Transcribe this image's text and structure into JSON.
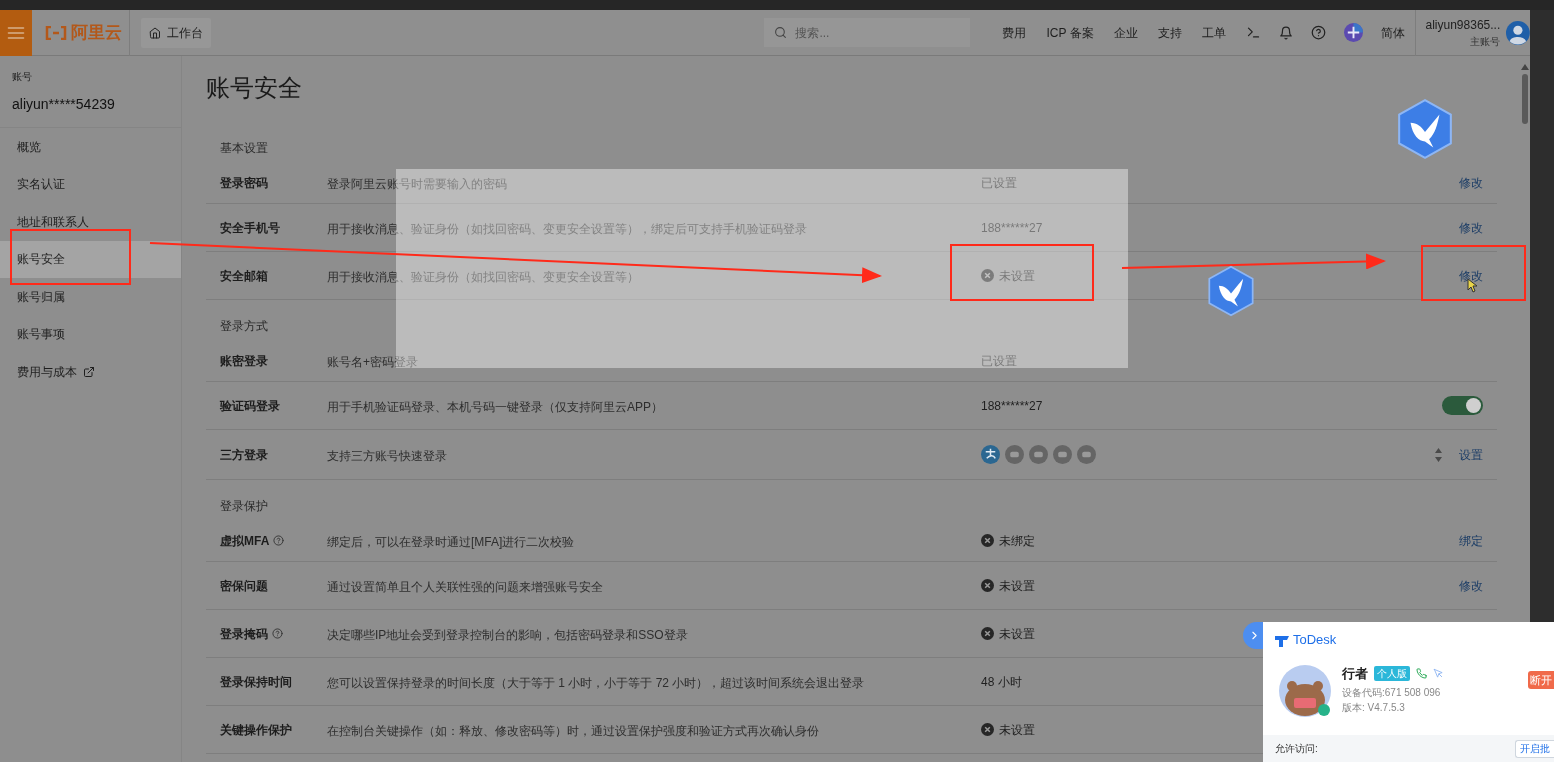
{
  "topbar": {
    "logo": "阿里云",
    "workbench": "工作台",
    "search": {
      "placeholder": "搜索..."
    },
    "nav": [
      "费用",
      "ICP 备案",
      "企业",
      "支持",
      "工单"
    ],
    "language": "简体",
    "user": {
      "name": "aliyun98365...",
      "role": "主账号"
    }
  },
  "sidebar": {
    "label": "账号",
    "account": "aliyun*****54239",
    "items": [
      {
        "label": "概览",
        "selected": false,
        "external": false
      },
      {
        "label": "实名认证",
        "selected": false,
        "external": false
      },
      {
        "label": "地址和联系人",
        "selected": false,
        "external": false
      },
      {
        "label": "账号安全",
        "selected": true,
        "external": false
      },
      {
        "label": "账号归属",
        "selected": false,
        "external": false
      },
      {
        "label": "账号事项",
        "selected": false,
        "external": false
      },
      {
        "label": "费用与成本",
        "selected": false,
        "external": true
      }
    ]
  },
  "page": {
    "title": "账号安全",
    "sections": [
      {
        "title": "基本设置",
        "rows": [
          {
            "kind": "link",
            "label": "登录密码",
            "help": false,
            "description": "登录阿里云账号时需要输入的密码",
            "status": "已设置",
            "unset": false,
            "action": "修改"
          },
          {
            "kind": "link",
            "label": "安全手机号",
            "help": false,
            "description": "用于接收消息、验证身份（如找回密码、变更安全设置等），绑定后可支持手机验证码登录",
            "status": "188******27",
            "unset": false,
            "action": "修改"
          },
          {
            "kind": "link",
            "label": "安全邮箱",
            "help": false,
            "description": "用于接收消息、验证身份（如找回密码、变更安全设置等）",
            "status": "未设置",
            "unset": true,
            "action": "修改"
          }
        ]
      },
      {
        "title": "登录方式",
        "rows": [
          {
            "kind": "none",
            "label": "账密登录",
            "help": false,
            "description": "账号名+密码登录",
            "status": "已设置",
            "unset": false
          },
          {
            "kind": "toggle",
            "label": "验证码登录",
            "help": false,
            "description": "用于手机验证码登录、本机号码一键登录（仅支持阿里云APP）",
            "status": "188******27",
            "unset": false,
            "on": true
          },
          {
            "kind": "providers",
            "label": "三方登录",
            "help": false,
            "description": "支持三方账号快速登录",
            "action": "设置"
          }
        ]
      },
      {
        "title": "登录保护",
        "rows": [
          {
            "kind": "link",
            "label": "虚拟MFA",
            "help": true,
            "description": "绑定后，可以在登录时通过[MFA]进行二次校验",
            "status": "未绑定",
            "unset": true,
            "action": "绑定"
          },
          {
            "kind": "link",
            "label": "密保问题",
            "help": false,
            "description": "通过设置简单且个人关联性强的问题来增强账号安全",
            "status": "未设置",
            "unset": true,
            "action": "修改"
          },
          {
            "kind": "none",
            "label": "登录掩码",
            "help": true,
            "description": "决定哪些IP地址会受到登录控制台的影响，包括密码登录和SSO登录",
            "status": "未设置",
            "unset": true
          },
          {
            "kind": "none",
            "label": "登录保持时间",
            "help": false,
            "description": "您可以设置保持登录的时间长度（大于等于 1 小时，小于等于 72 小时），超过该时间系统会退出登录",
            "status": "48 小时",
            "unset": false
          },
          {
            "kind": "none",
            "label": "关键操作保护",
            "help": false,
            "description": "在控制台关键操作（如：释放、修改密码等）时，通过设置保护强度和验证方式再次确认身份",
            "status": "未设置",
            "unset": true
          }
        ]
      }
    ]
  },
  "todesk": {
    "title": "ToDesk",
    "name": "行者",
    "badge": "个人版",
    "device_code": "设备代码:671 508 096",
    "version": "版本: V4.7.5.3",
    "disconnect": "断开",
    "access_label": "允许访问:",
    "access_button": "开启批"
  }
}
